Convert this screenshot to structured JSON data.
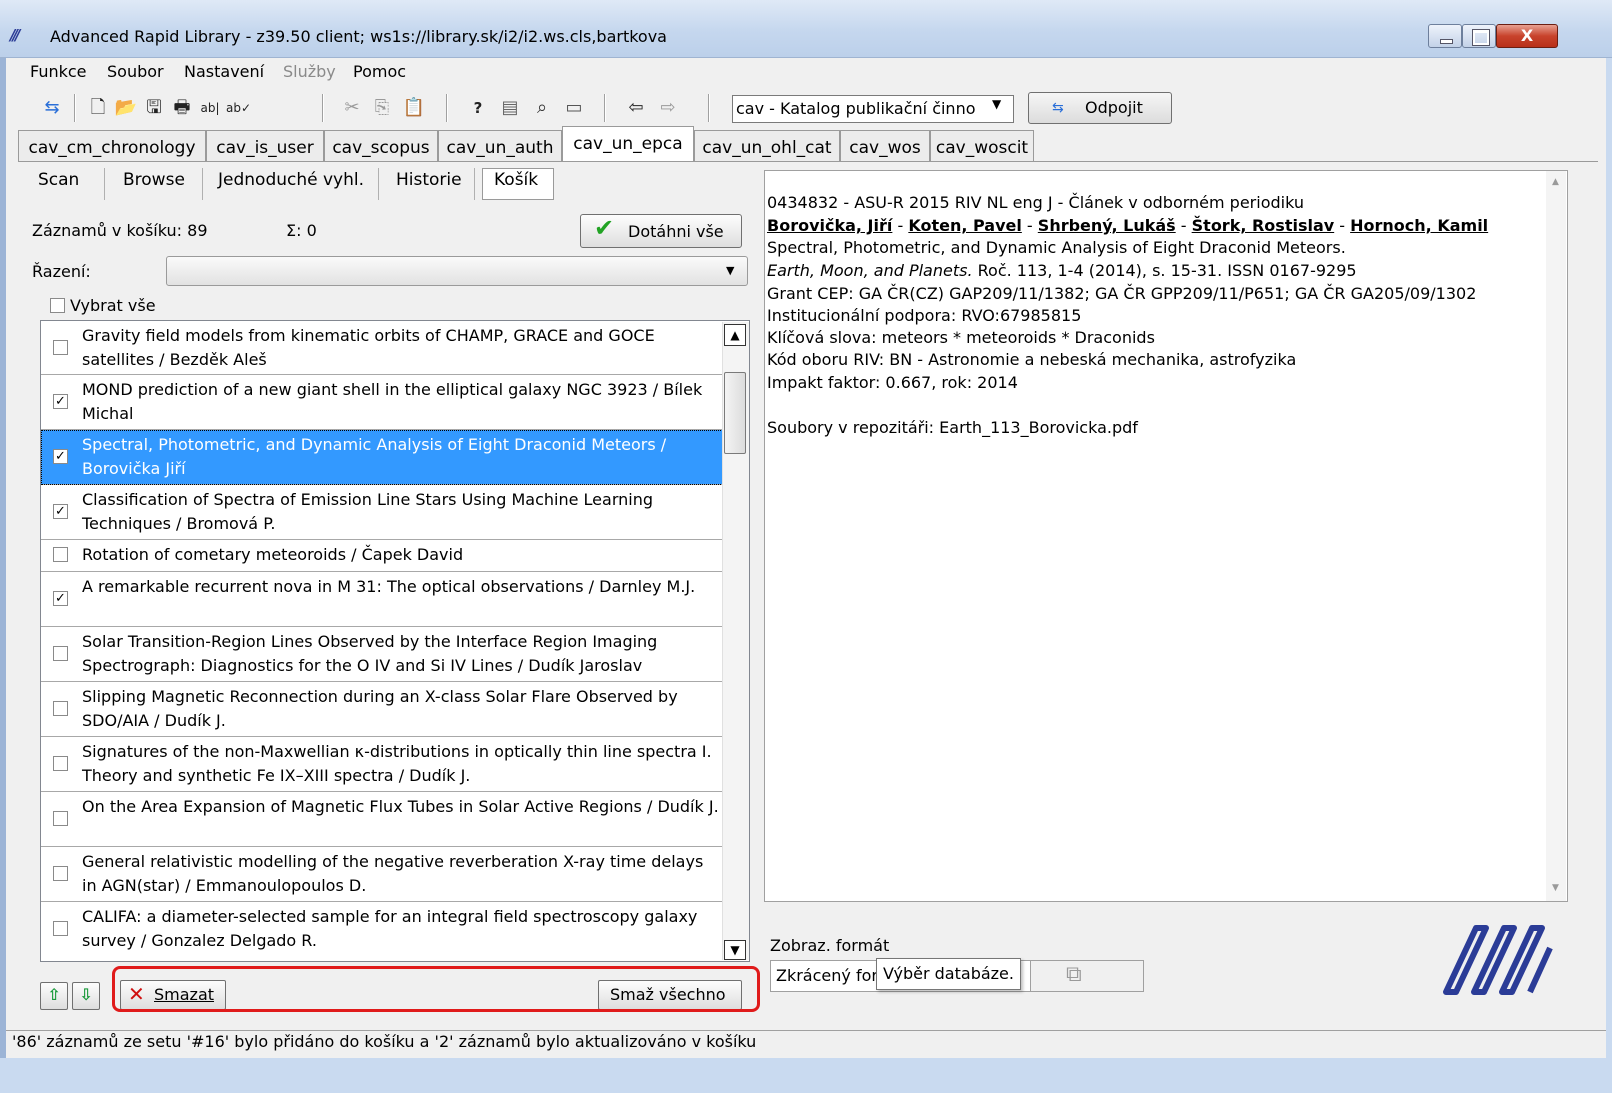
{
  "window": {
    "title": "Advanced Rapid Library - z39.50 client; ws1s://library.sk/i2/i2.ws.cls,bartkova",
    "icon": "app-logo-icon",
    "close_glyph": "X"
  },
  "menu": [
    "Funkce",
    "Soubor",
    "Nastavení",
    "Služby",
    "Pomoc"
  ],
  "toolbar": {
    "db_select_value": "cav - Katalog publikační činno",
    "disconnect_label": "Odpojit"
  },
  "db_tabs": [
    "cav_cm_chronology",
    "cav_is_user",
    "cav_scopus",
    "cav_un_auth",
    "cav_un_epca",
    "cav_un_ohl_cat",
    "cav_wos",
    "cav_woscit"
  ],
  "active_db_tab": "cav_un_epca",
  "sub_tabs": [
    "Scan",
    "Browse",
    "Jednoduché vyhl.",
    "Historie",
    "Košík"
  ],
  "basket": {
    "count_label": "Záznamů v košíku: 89",
    "sum_label": "Σ: 0",
    "fetch_all_label": "Dotáhni vše",
    "sort_label": "Řazení:",
    "sort_value": "",
    "select_all_label": "Vybrat vše",
    "items": [
      {
        "text": "Gravity field models from kinematic orbits of CHAMP, GRACE and GOCE satellites / Bezděk Aleš",
        "checked": false,
        "selected": false
      },
      {
        "text": "MOND prediction of a new giant shell in the elliptical galaxy NGC 3923 / Bílek Michal",
        "checked": true,
        "selected": false
      },
      {
        "text": "Spectral, Photometric, and Dynamic Analysis of Eight Draconid Meteors / Borovička Jiří",
        "checked": true,
        "selected": true
      },
      {
        "text": "Classification of Spectra of Emission Line Stars Using Machine Learning Techniques / Bromová P.",
        "checked": true,
        "selected": false
      },
      {
        "text": "Rotation of cometary meteoroids / Čapek David",
        "checked": false,
        "selected": false
      },
      {
        "text": "A remarkable recurrent nova in M 31: The optical observations / Darnley M.J.",
        "checked": true,
        "selected": false
      },
      {
        "text": "Solar Transition-Region Lines Observed by the Interface Region Imaging Spectrograph: Diagnostics for the O IV and Si IV Lines / Dudík Jaroslav",
        "checked": false,
        "selected": false
      },
      {
        "text": "Slipping Magnetic Reconnection during an X-class Solar Flare Observed by SDO/AIA / Dudík J.",
        "checked": false,
        "selected": false
      },
      {
        "text": "Signatures of the non-Maxwellian κ-distributions in optically thin line spectra I. Theory and synthetic Fe IX–XIII spectra / Dudík J.",
        "checked": false,
        "selected": false
      },
      {
        "text": "On the Area Expansion of Magnetic Flux Tubes in Solar Active Regions / Dudík J.",
        "checked": false,
        "selected": false
      },
      {
        "text": "General relativistic modelling of the negative reverberation X-ray time delays in AGN(star) / Emmanoulopoulos D.",
        "checked": false,
        "selected": false
      },
      {
        "text": "CALIFA: a diameter-selected sample for an integral field spectroscopy galaxy survey / Gonzalez Delgado R.",
        "checked": false,
        "selected": false
      }
    ],
    "delete_label": "Smazat",
    "delete_all_label": "Smaž všechno"
  },
  "detail": {
    "line1": "0434832 - ASU-R 2015 RIV NL eng J - Článek v odborném periodiku",
    "authors": [
      "Borovička, Jiří",
      "Koten, Pavel",
      "Shrbený, Lukáš",
      "Štork, Rostislav",
      "Hornoch, Kamil"
    ],
    "author_sep": " - ",
    "title": "Spectral, Photometric, and Dynamic Analysis of Eight Draconid Meteors.",
    "journal": "Earth, Moon, and Planets.",
    "journal_rest": " Roč. 113, 1-4 (2014), s. 15-31. ISSN 0167-9295",
    "grant": "Grant CEP: GA ČR(CZ) GAP209/11/1382; GA ČR GPP209/11/P651; GA ČR GA205/09/1302",
    "support": "Institucionální podpora: RVO:67985815",
    "keywords": "Klíčová slova: meteors * meteoroids * Draconids",
    "riv": "Kód oboru RIV: BN - Astronomie a nebeská mechanika, astrofyzika",
    "impact": "Impakt faktor: 0.667, rok: 2014",
    "files": "Soubory v repozitáři: Earth_113_Borovicka.pdf"
  },
  "format": {
    "label": "Zobraz. formát",
    "value": "Zkrácený for",
    "tooltip": "Výběr databáze."
  },
  "status": "'86' záznamů ze setu '#16' bylo přidáno do košíku a '2' záznamů bylo aktualizováno v košíku",
  "colors": {
    "selection": "#3399ff",
    "highlight_box": "#e01b1b",
    "logo": "#2b3c97"
  }
}
